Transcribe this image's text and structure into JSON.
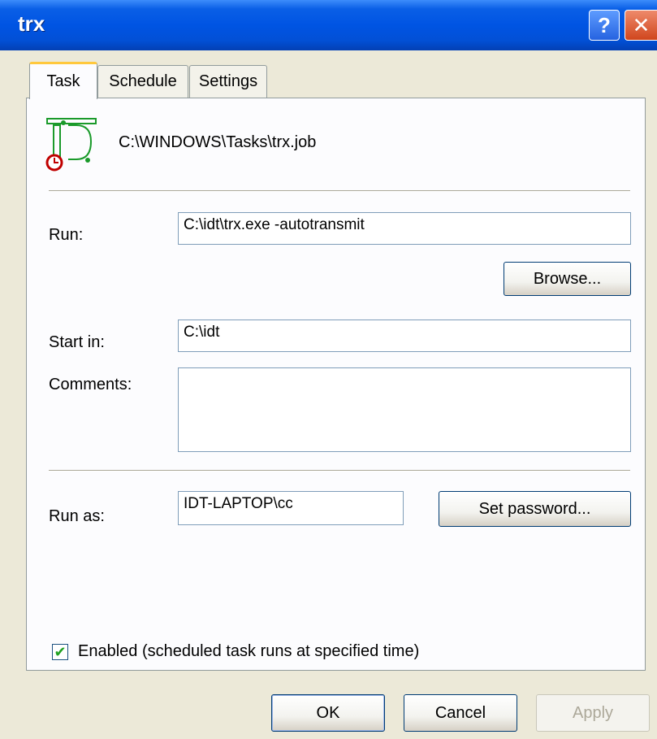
{
  "window": {
    "title": "trx"
  },
  "titlebar": {
    "help_icon": "help-icon",
    "close_icon": "close-icon",
    "help_glyph": "?",
    "close_glyph": "✕"
  },
  "tabs": [
    {
      "label": "Task",
      "active": true
    },
    {
      "label": "Schedule",
      "active": false
    },
    {
      "label": "Settings",
      "active": false
    }
  ],
  "task": {
    "icon": "scheduled-task-icon",
    "path": "C:\\WINDOWS\\Tasks\\trx.job",
    "run_label": "Run:",
    "run_value": "C:\\idt\\trx.exe -autotransmit",
    "browse_label": "Browse...",
    "start_in_label": "Start in:",
    "start_in_value": "C:\\idt",
    "comments_label": "Comments:",
    "comments_value": "",
    "run_as_label": "Run as:",
    "run_as_value": "IDT-LAPTOP\\cc",
    "set_password_label": "Set password...",
    "enabled_label": "Enabled (scheduled task runs at specified time)",
    "enabled_checked": true
  },
  "footer": {
    "ok_label": "OK",
    "cancel_label": "Cancel",
    "apply_label": "Apply"
  },
  "colors": {
    "titlebar": "#0054e3",
    "dialog_bg": "#ece9d8",
    "panel_bg": "#fcfcfe",
    "active_tab_accent": "#ffc83c",
    "icon_green": "#1a9a2a",
    "icon_red": "#c00000"
  }
}
